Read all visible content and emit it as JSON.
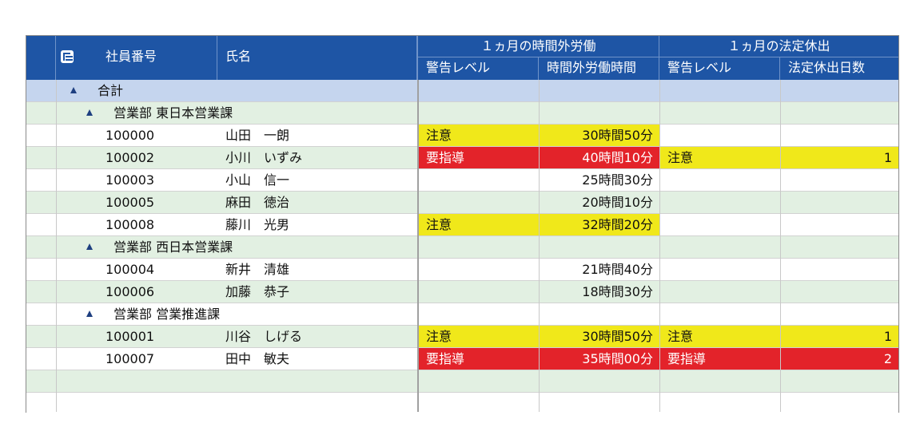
{
  "header": {
    "col_id": "社員番号",
    "col_name": "氏名",
    "group_overtime": "１ヵ月の時間外労働",
    "group_holiday": "１ヵ月の法定休出",
    "overtime_level": "警告レベル",
    "overtime_hours": "時間外労働時間",
    "holiday_level": "警告レベル",
    "holiday_days": "法定休出日数"
  },
  "total_label": "合計",
  "groups": [
    {
      "label": "営業部 東日本営業課",
      "rows": [
        {
          "id": "100000",
          "name": "山田　一朗",
          "ot_level": "注意",
          "ot_hours": "30時間50分",
          "hol_level": "",
          "hol_days": ""
        },
        {
          "id": "100002",
          "name": "小川　いずみ",
          "ot_level": "要指導",
          "ot_hours": "40時間10分",
          "hol_level": "注意",
          "hol_days": "1"
        },
        {
          "id": "100003",
          "name": "小山　信一",
          "ot_level": "",
          "ot_hours": "25時間30分",
          "hol_level": "",
          "hol_days": ""
        },
        {
          "id": "100005",
          "name": "麻田　徳治",
          "ot_level": "",
          "ot_hours": "20時間10分",
          "hol_level": "",
          "hol_days": ""
        },
        {
          "id": "100008",
          "name": "藤川　光男",
          "ot_level": "注意",
          "ot_hours": "32時間20分",
          "hol_level": "",
          "hol_days": ""
        }
      ]
    },
    {
      "label": "営業部 西日本営業課",
      "rows": [
        {
          "id": "100004",
          "name": "新井　清雄",
          "ot_level": "",
          "ot_hours": "21時間40分",
          "hol_level": "",
          "hol_days": ""
        },
        {
          "id": "100006",
          "name": "加藤　恭子",
          "ot_level": "",
          "ot_hours": "18時間30分",
          "hol_level": "",
          "hol_days": ""
        }
      ]
    },
    {
      "label": "営業部 営業推進課",
      "rows": [
        {
          "id": "100001",
          "name": "川谷　しげる",
          "ot_level": "注意",
          "ot_hours": "30時間50分",
          "hol_level": "注意",
          "hol_days": "1"
        },
        {
          "id": "100007",
          "name": "田中　敏夫",
          "ot_level": "要指導",
          "ot_hours": "35時間00分",
          "hol_level": "要指導",
          "hol_days": "2"
        }
      ]
    }
  ],
  "colors": {
    "header": "#1e55a5",
    "warning_caution": "#f0e81a",
    "warning_guidance": "#e3232a",
    "row_alt": "#e2f0e2",
    "total_row": "#c5d5ee"
  }
}
